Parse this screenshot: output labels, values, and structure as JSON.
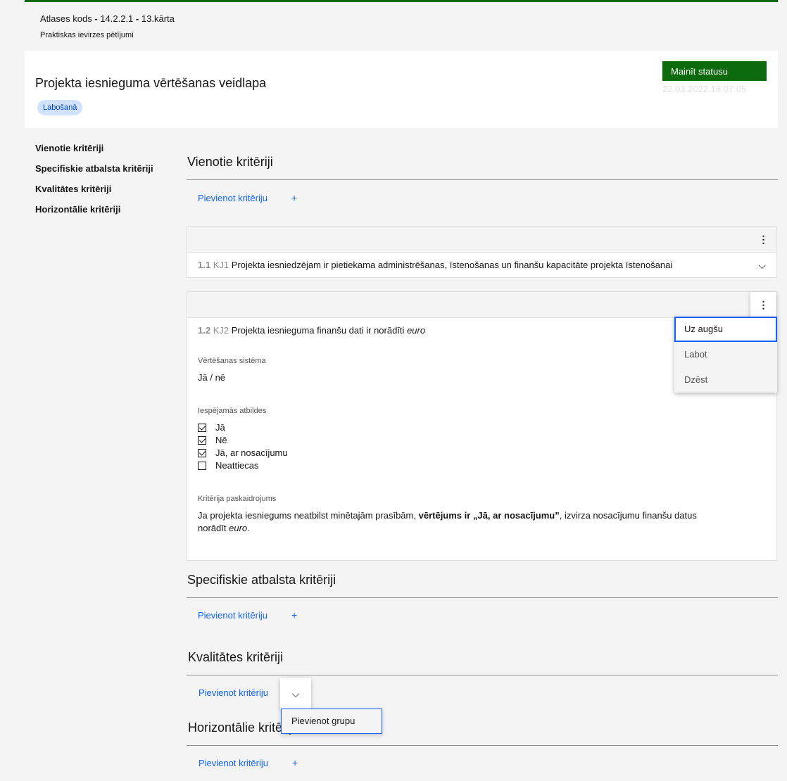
{
  "breadcrumb": {
    "label": "Atlases kods",
    "sep": "-",
    "code": "14.2.2.1",
    "round": "13.kārta"
  },
  "subtitle": "Praktiskas ievirzes pētījumi",
  "header": {
    "title": "Projekta iesnieguma vērtēšanas veidlapa",
    "status_tag": "Labošanā",
    "change_status_label": "Mainīt statusu",
    "status_date": "22.03.2022 16:07:05"
  },
  "sidenav": {
    "items": [
      {
        "label": "Vienotie kritēriji"
      },
      {
        "label": "Specifiskie atbalsta kritēriji"
      },
      {
        "label": "Kvalitātes kritēriji"
      },
      {
        "label": "Horizontālie kritēriji"
      }
    ]
  },
  "sections": [
    {
      "title": "Vienotie kritēriji",
      "add_label": "Pievienot kritēriju",
      "plus": "+"
    },
    {
      "title": "Specifiskie atbalsta kritēriji",
      "add_label": "Pievienot kritēriju",
      "plus": "+"
    },
    {
      "title": "Kvalitātes kritēriji",
      "add_label": "Pievienot kritēriju"
    },
    {
      "title": "Horizontālie kritēriji",
      "add_label": "Pievienot kritēriju",
      "plus": "+"
    }
  ],
  "criteria": [
    {
      "num": "1.1",
      "code": "KJ1",
      "text": "Projekta iesniedzējam ir pietiekama administrēšanas, īstenošanas un finanšu kapacitāte projekta īstenošanai"
    },
    {
      "num": "1.2",
      "code": "KJ2",
      "text": "Projekta iesnieguma finanšu dati ir norādīti",
      "text_italic": "euro",
      "system_label": "Vērtēšanas sistēma",
      "system_value": "Jā / nē",
      "answers_label": "Iespējamās atbildes",
      "answers": [
        {
          "label": "Jā",
          "checked": true
        },
        {
          "label": "Nē",
          "checked": true
        },
        {
          "label": "Jā, ar nosacījumu",
          "checked": true
        },
        {
          "label": "Neattiecas",
          "checked": false
        }
      ],
      "explain_label": "Kritērija paskaidrojums",
      "explain_pre": "Ja projekta iesniegums neatbilst minētajām prasībām,",
      "explain_bold": "vērtējums ir „Jā, ar nosacījumu”",
      "explain_post": ", izvirza nosacījumu finanšu datus norādīt",
      "explain_italic": "euro",
      "explain_end": "."
    }
  ],
  "context_menu": {
    "items": [
      "Uz augšu",
      "Labot",
      "Dzēst"
    ]
  },
  "group_dropdown": {
    "item": "Pievienot grupu"
  },
  "icons": {
    "kebab": "overflow-menu-icon",
    "chevron": "chevron-down-icon"
  },
  "colors": {
    "brand_green": "#0b6a0b",
    "link_blue": "#0f62fe",
    "tag_bg": "#d0e2ff"
  }
}
